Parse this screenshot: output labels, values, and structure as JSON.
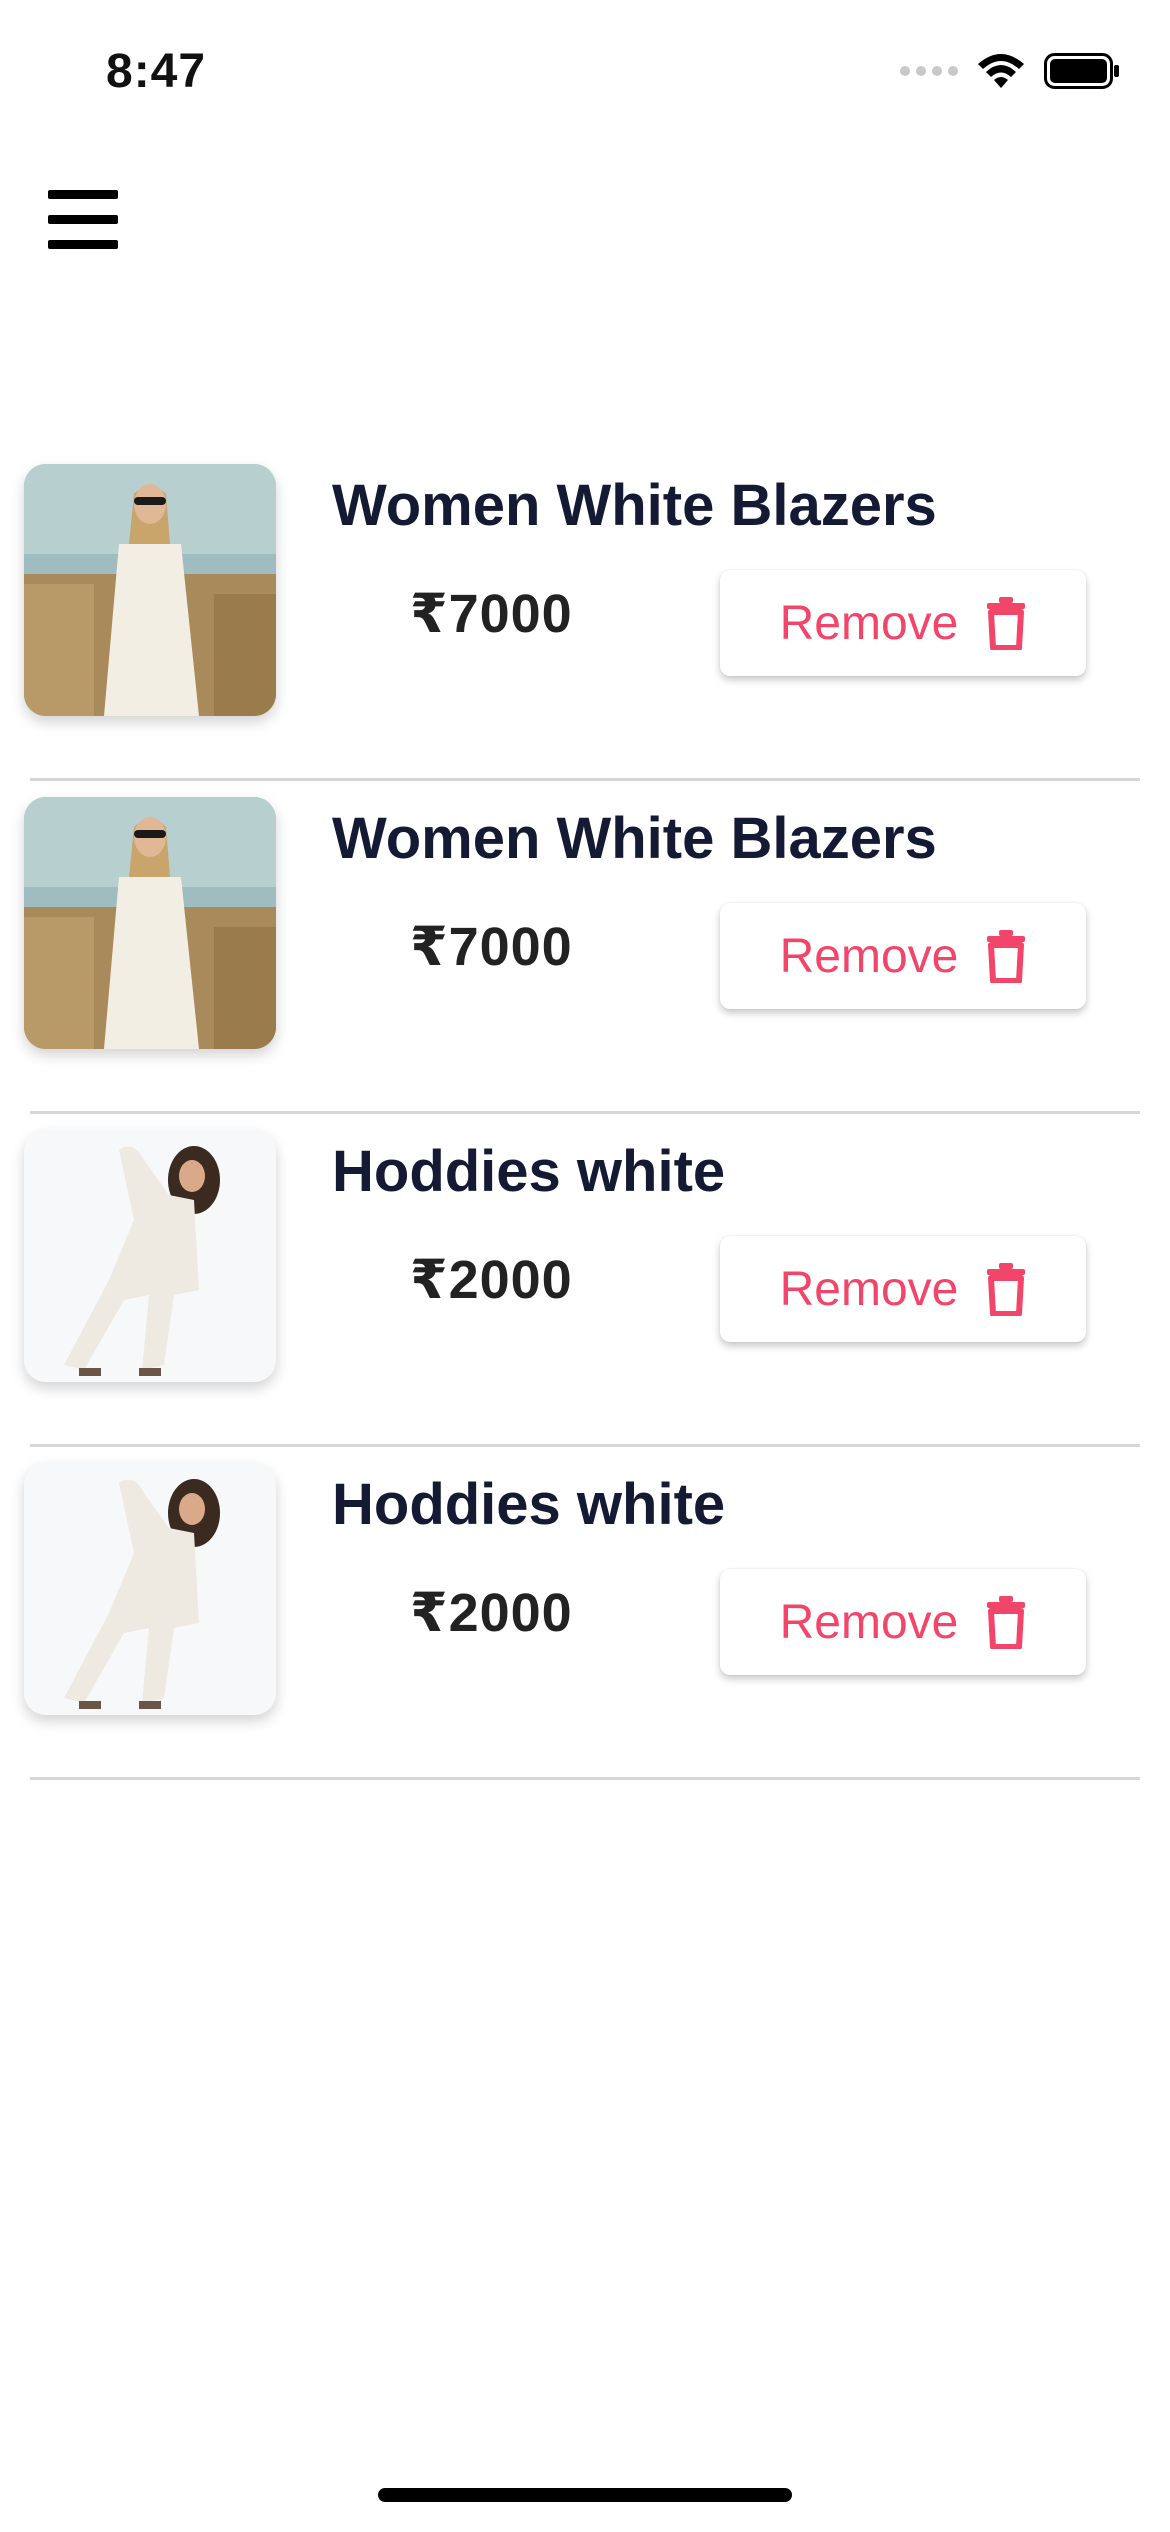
{
  "status_bar": {
    "time": "8:47"
  },
  "header": {
    "menu_icon": "hamburger-menu-icon"
  },
  "cart": {
    "items": [
      {
        "title": "Women White Blazers",
        "price": "₹7000",
        "remove_label": "Remove",
        "image": "blazer"
      },
      {
        "title": "Women White Blazers",
        "price": "₹7000",
        "remove_label": "Remove",
        "image": "blazer"
      },
      {
        "title": "Hoddies white",
        "price": "₹2000",
        "remove_label": "Remove",
        "image": "hoodie"
      },
      {
        "title": "Hoddies white",
        "price": "₹2000",
        "remove_label": "Remove",
        "image": "hoodie"
      }
    ]
  },
  "colors": {
    "accent": "#f2456a",
    "title_text": "#141a33",
    "divider": "#d6d6d6"
  }
}
